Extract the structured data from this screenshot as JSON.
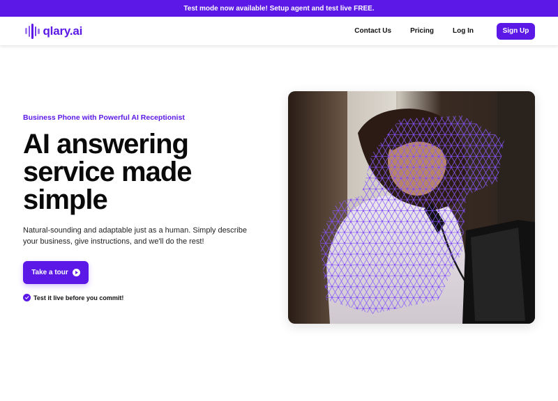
{
  "banner": {
    "text": "Test mode now available! Setup agent and test live FREE."
  },
  "nav": {
    "logo_text": "qlary.ai",
    "links": [
      "Contact Us",
      "Pricing",
      "Log In"
    ],
    "signup_label": "Sign Up"
  },
  "hero": {
    "eyebrow": "Business Phone with Powerful AI Receptionist",
    "headline": "AI answering service made simple",
    "subtext": "Natural-sounding and adaptable just as a human. Simply describe your business, give instructions, and we'll do the rest!",
    "cta_label": "Take a tour",
    "check_text": "Test it live before you commit!"
  },
  "colors": {
    "accent": "#5b18e6",
    "text": "#0a0a0a"
  },
  "icons": [
    "play-icon",
    "check-icon",
    "logo-bars-icon"
  ]
}
